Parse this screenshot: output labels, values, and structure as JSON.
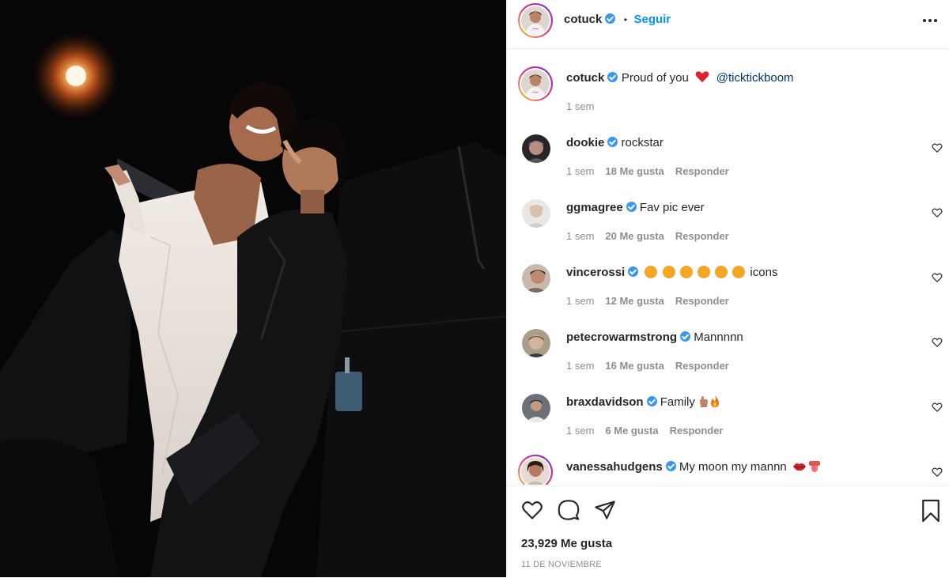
{
  "post": {
    "username": "cotuck",
    "follow_label": "Seguir",
    "follow_separator": "•",
    "more_label": "•••"
  },
  "caption": {
    "username": "cotuck",
    "text_before": "Proud of you",
    "mention": "@ticktickboom",
    "time": "1 sem"
  },
  "comments": [
    {
      "username": "dookie",
      "text": "rockstar",
      "time": "1 sem",
      "likes": "18 Me gusta",
      "reply": "Responder"
    },
    {
      "username": "ggmagree",
      "text": "Fav pic ever",
      "time": "1 sem",
      "likes": "20 Me gusta",
      "reply": "Responder"
    },
    {
      "username": "vincerossi",
      "text": "icons",
      "time": "1 sem",
      "likes": "12 Me gusta",
      "reply": "Responder"
    },
    {
      "username": "petecrowarmstrong",
      "text": "Mannnnn",
      "time": "1 sem",
      "likes": "16 Me gusta",
      "reply": "Responder"
    },
    {
      "username": "braxdavidson",
      "text": "Family",
      "time": "1 sem",
      "likes": "6 Me gusta",
      "reply": "Responder"
    },
    {
      "username": "vanessahudgens",
      "text": "My moon my mannn",
      "time": "",
      "likes": "",
      "reply": ""
    }
  ],
  "footer": {
    "likes": "23,929 Me gusta",
    "date": "11 DE NOVIEMBRE"
  },
  "colors": {
    "link": "#0095f6",
    "mention": "#00376b",
    "verified": "#3897f0",
    "muted": "#8e8e8e",
    "text": "#262626"
  },
  "icons": [
    "verified-badge",
    "heart-icon",
    "comment-icon",
    "share-icon",
    "bookmark-icon",
    "more-icon"
  ]
}
